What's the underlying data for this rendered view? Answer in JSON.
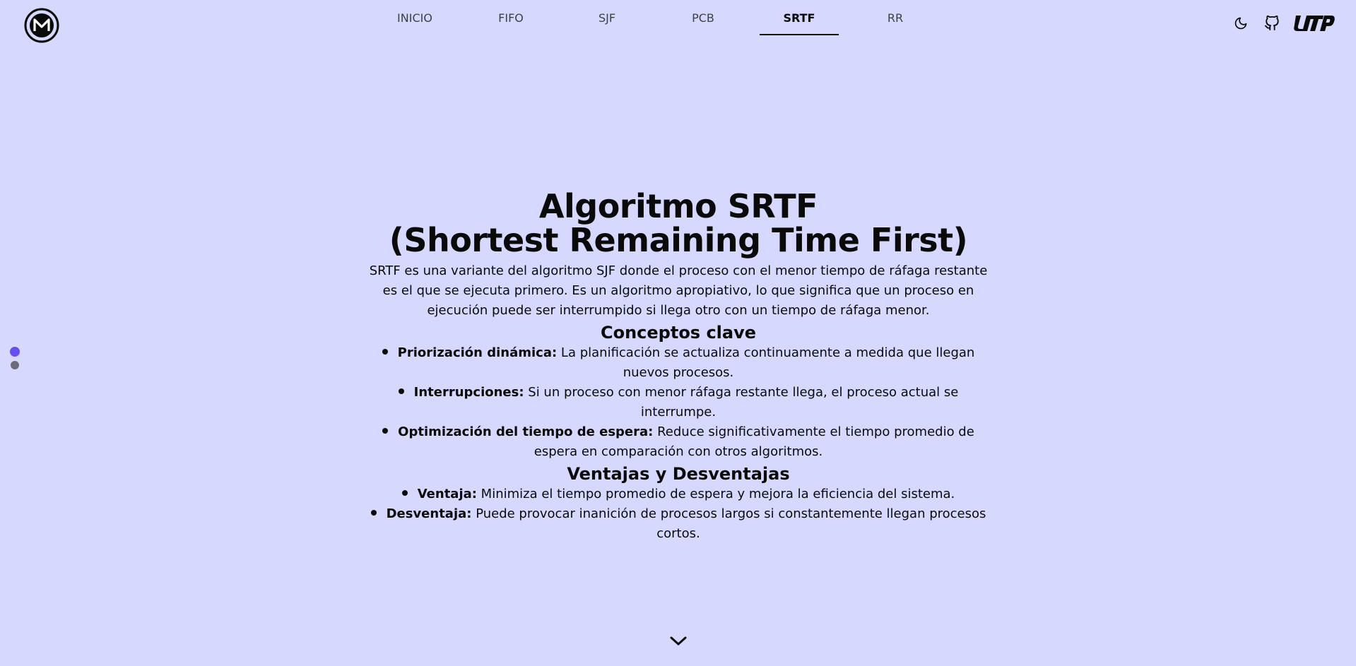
{
  "nav": {
    "items": [
      {
        "label": "INICIO",
        "active": false
      },
      {
        "label": "FIFO",
        "active": false
      },
      {
        "label": "SJF",
        "active": false
      },
      {
        "label": "PCB",
        "active": false
      },
      {
        "label": "SRTF",
        "active": true
      },
      {
        "label": "RR",
        "active": false
      }
    ]
  },
  "header": {
    "icons": [
      "moon-icon",
      "github-icon",
      "utp-logo"
    ]
  },
  "side_nav": {
    "dots": [
      {
        "active": true,
        "color": "#6a4df0"
      },
      {
        "active": false,
        "color": "#6b6b7b"
      }
    ]
  },
  "content": {
    "title_line1": "Algoritmo SRTF",
    "title_line2": "(Shortest Remaining Time First)",
    "intro": "SRTF es una variante del algoritmo SJF donde el proceso con el menor tiempo de ráfaga restante es el que se ejecuta primero. Es un algoritmo apropiativo, lo que significa que un proceso en ejecución puede ser interrumpido si llega otro con un tiempo de ráfaga menor.",
    "concepts_heading": "Conceptos clave",
    "concepts": [
      {
        "term": "Priorización dinámica:",
        "text": " La planificación se actualiza continuamente a medida que llegan nuevos procesos."
      },
      {
        "term": "Interrupciones:",
        "text": " Si un proceso con menor ráfaga restante llega, el proceso actual se interrumpe."
      },
      {
        "term": "Optimización del tiempo de espera:",
        "text": " Reduce significativamente el tiempo promedio de espera en comparación con otros algoritmos."
      }
    ],
    "pros_cons_heading": "Ventajas y Desventajas",
    "pros_cons": [
      {
        "term": "Ventaja:",
        "text": " Minimiza el tiempo promedio de espera y mejora la eficiencia del sistema."
      },
      {
        "term": "Desventaja:",
        "text": " Puede provocar inanición de procesos largos si constantemente llegan procesos cortos."
      }
    ]
  },
  "colors": {
    "background": "#d6d9fd",
    "accent": "#6a4df0",
    "text": "#0a0a0a"
  }
}
